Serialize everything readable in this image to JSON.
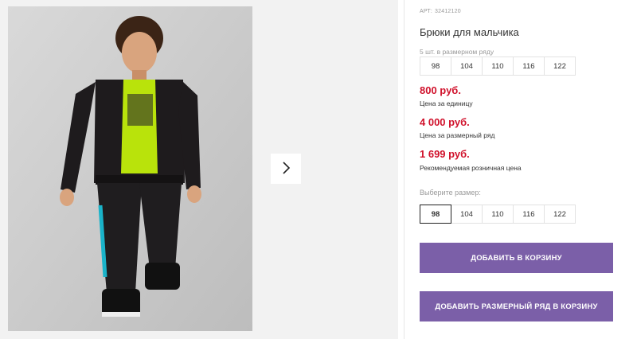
{
  "product": {
    "article_label": "Арт:",
    "article_number": "32412120",
    "title": "Брюки для мальчика",
    "pack_note": "5 шт. в размерном ряду",
    "pack_sizes": [
      "98",
      "104",
      "110",
      "116",
      "122"
    ]
  },
  "prices": [
    {
      "value": "800 руб.",
      "label": "Цена за единицу"
    },
    {
      "value": "4 000 руб.",
      "label": "Цена за размерный ряд"
    },
    {
      "value": "1 699 руб.",
      "label": "Рекомендуемая розничная цена"
    }
  ],
  "size_picker": {
    "label": "Выберите размер:",
    "options": [
      "98",
      "104",
      "110",
      "116",
      "122"
    ],
    "selected": "98"
  },
  "actions": {
    "add_to_cart": "Добавить в корзину",
    "add_size_set": "Добавить размерный ряд в корзину"
  },
  "gallery": {
    "next_icon": "chevron-right-icon"
  },
  "colors": {
    "price": "#d0112b",
    "button": "#7b5fa8"
  }
}
